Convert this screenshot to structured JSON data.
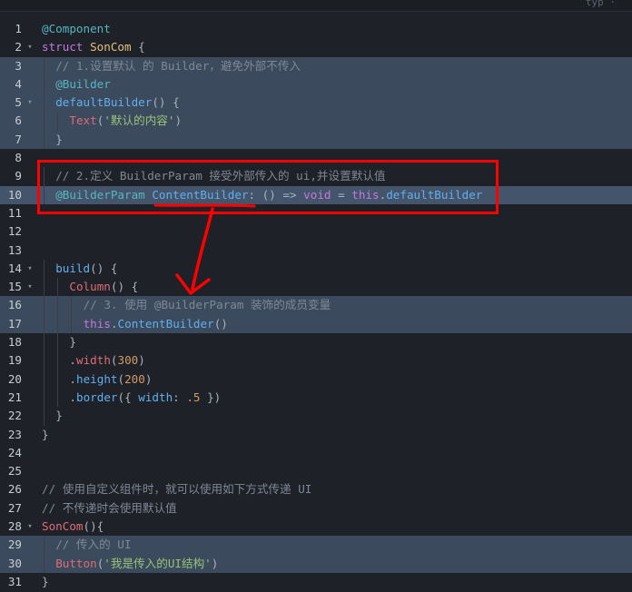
{
  "editor": {
    "top_right_text": "typ  ·",
    "lines": [
      {
        "num": "1",
        "fold": "",
        "indent": 0,
        "hl": "",
        "tokens": [
          [
            "deco",
            "@Component"
          ]
        ]
      },
      {
        "num": "2",
        "fold": "▾",
        "indent": 0,
        "hl": "",
        "tokens": [
          [
            "kw",
            "struct "
          ],
          [
            "type",
            "SonCom"
          ],
          [
            "plain",
            " {"
          ]
        ]
      },
      {
        "num": "3",
        "fold": "",
        "indent": 2,
        "hl": "hl",
        "tokens": [
          [
            "cmt",
            "// 1.设置默认 的 Builder，避免外部不传入"
          ]
        ]
      },
      {
        "num": "4",
        "fold": "",
        "indent": 2,
        "hl": "hl",
        "tokens": [
          [
            "deco",
            "@Builder"
          ]
        ]
      },
      {
        "num": "5",
        "fold": "▾",
        "indent": 2,
        "hl": "hl",
        "tokens": [
          [
            "fn",
            "defaultBuilder"
          ],
          [
            "plain",
            "() {"
          ]
        ]
      },
      {
        "num": "6",
        "fold": "",
        "indent": 4,
        "hl": "hl",
        "tokens": [
          [
            "prop",
            "Text"
          ],
          [
            "plain",
            "("
          ],
          [
            "str",
            "'默认的内容'"
          ],
          [
            "plain",
            ")"
          ]
        ]
      },
      {
        "num": "7",
        "fold": "",
        "indent": 2,
        "hl": "hl",
        "tokens": [
          [
            "plain",
            "}"
          ]
        ]
      },
      {
        "num": "8",
        "fold": "",
        "indent": 0,
        "hl": "",
        "tokens": []
      },
      {
        "num": "9",
        "fold": "",
        "indent": 2,
        "hl": "",
        "tokens": [
          [
            "cmt",
            "// 2.定义 BuilderParam 接受外部传入的 ui,并设置默认值"
          ]
        ]
      },
      {
        "num": "10",
        "fold": "",
        "indent": 2,
        "hl": "hl-strong",
        "tokens": [
          [
            "deco",
            "@BuilderParam "
          ],
          [
            "fn",
            "ContentBuilder"
          ],
          [
            "plain",
            ": () => "
          ],
          [
            "kw",
            "void"
          ],
          [
            "plain",
            " = "
          ],
          [
            "kw",
            "this"
          ],
          [
            "plain",
            "."
          ],
          [
            "fn",
            "defaultBuilder"
          ]
        ]
      },
      {
        "num": "11",
        "fold": "",
        "indent": 0,
        "hl": "",
        "tokens": []
      },
      {
        "num": "12",
        "fold": "",
        "indent": 0,
        "hl": "",
        "tokens": []
      },
      {
        "num": "13",
        "fold": "",
        "indent": 0,
        "hl": "",
        "tokens": []
      },
      {
        "num": "14",
        "fold": "▾",
        "indent": 2,
        "hl": "",
        "tokens": [
          [
            "fn",
            "build"
          ],
          [
            "plain",
            "() {"
          ]
        ]
      },
      {
        "num": "15",
        "fold": "▾",
        "indent": 4,
        "hl": "",
        "tokens": [
          [
            "prop",
            "Column"
          ],
          [
            "plain",
            "() {"
          ]
        ]
      },
      {
        "num": "16",
        "fold": "",
        "indent": 6,
        "hl": "hl",
        "tokens": [
          [
            "cmt",
            "// 3. 使用 @BuilderParam 装饰的成员变量"
          ]
        ]
      },
      {
        "num": "17",
        "fold": "",
        "indent": 6,
        "hl": "hl",
        "tokens": [
          [
            "kw",
            "this"
          ],
          [
            "plain",
            "."
          ],
          [
            "fn",
            "ContentBuilder"
          ],
          [
            "plain",
            "()"
          ]
        ]
      },
      {
        "num": "18",
        "fold": "",
        "indent": 4,
        "hl": "",
        "tokens": [
          [
            "plain",
            "}"
          ]
        ]
      },
      {
        "num": "19",
        "fold": "",
        "indent": 4,
        "hl": "",
        "tokens": [
          [
            "plain",
            "."
          ],
          [
            "prop",
            "width"
          ],
          [
            "plain",
            "("
          ],
          [
            "num",
            "300"
          ],
          [
            "plain",
            ")"
          ]
        ]
      },
      {
        "num": "20",
        "fold": "",
        "indent": 4,
        "hl": "",
        "tokens": [
          [
            "plain",
            "."
          ],
          [
            "fn",
            "height"
          ],
          [
            "plain",
            "("
          ],
          [
            "num",
            "200"
          ],
          [
            "plain",
            ")"
          ]
        ]
      },
      {
        "num": "21",
        "fold": "",
        "indent": 4,
        "hl": "",
        "tokens": [
          [
            "plain",
            "."
          ],
          [
            "fn",
            "border"
          ],
          [
            "plain",
            "({ "
          ],
          [
            "fn",
            "width"
          ],
          [
            "plain",
            ": "
          ],
          [
            "num",
            ".5"
          ],
          [
            "plain",
            " })"
          ]
        ]
      },
      {
        "num": "22",
        "fold": "",
        "indent": 2,
        "hl": "",
        "tokens": [
          [
            "plain",
            "}"
          ]
        ]
      },
      {
        "num": "23",
        "fold": "",
        "indent": 0,
        "hl": "",
        "tokens": [
          [
            "plain",
            "}"
          ]
        ]
      },
      {
        "num": "24",
        "fold": "",
        "indent": 0,
        "hl": "",
        "tokens": []
      },
      {
        "num": "25",
        "fold": "",
        "indent": 0,
        "hl": "",
        "tokens": []
      },
      {
        "num": "26",
        "fold": "",
        "indent": 0,
        "hl": "",
        "tokens": [
          [
            "cmt",
            "// 使用自定义组件时，就可以使用如下方式传递 UI"
          ]
        ]
      },
      {
        "num": "27",
        "fold": "",
        "indent": 0,
        "hl": "",
        "tokens": [
          [
            "cmt",
            "// 不传递时会使用默认值"
          ]
        ]
      },
      {
        "num": "28",
        "fold": "▾",
        "indent": 0,
        "hl": "",
        "tokens": [
          [
            "prop",
            "SonCom"
          ],
          [
            "plain",
            "(){"
          ]
        ]
      },
      {
        "num": "29",
        "fold": "",
        "indent": 2,
        "hl": "hl",
        "tokens": [
          [
            "cmt",
            "// 传入的 UI"
          ]
        ]
      },
      {
        "num": "30",
        "fold": "",
        "indent": 2,
        "hl": "hl",
        "tokens": [
          [
            "prop",
            "Button"
          ],
          [
            "plain",
            "("
          ],
          [
            "str",
            "'我是传入的UI结构'"
          ],
          [
            "plain",
            ")"
          ]
        ]
      },
      {
        "num": "31",
        "fold": "",
        "indent": 0,
        "hl": "",
        "tokens": [
          [
            "plain",
            "}"
          ]
        ]
      }
    ]
  },
  "colors": {
    "background": "#1e2127",
    "highlight": "#3b4a5c",
    "annotation": "#ff0000"
  },
  "annotation": {
    "box_icon": "red-rectangle-annotation",
    "underline_icon": "red-underline-annotation",
    "arrow_icon": "red-arrow-annotation"
  }
}
